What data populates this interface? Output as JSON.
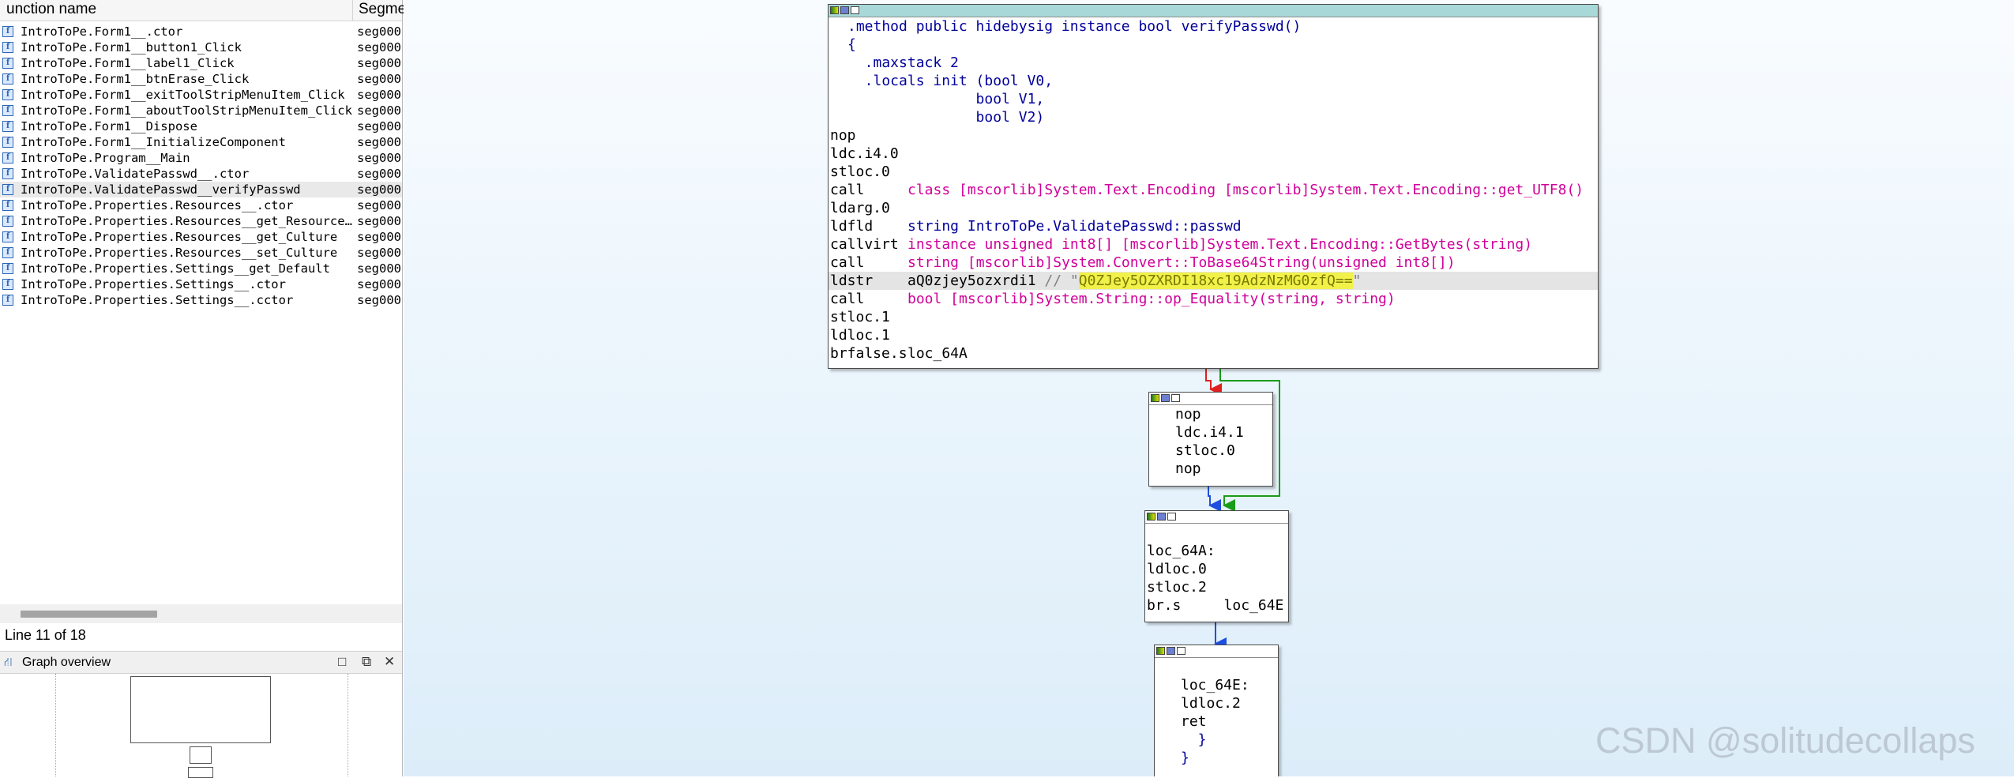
{
  "functions_panel": {
    "header": {
      "name": "unction name",
      "segment": "Segme"
    },
    "rows": [
      {
        "name": "IntroToPe.Form1__.ctor",
        "segment": "seg000"
      },
      {
        "name": "IntroToPe.Form1__button1_Click",
        "segment": "seg000"
      },
      {
        "name": "IntroToPe.Form1__label1_Click",
        "segment": "seg000"
      },
      {
        "name": "IntroToPe.Form1__btnErase_Click",
        "segment": "seg000"
      },
      {
        "name": "IntroToPe.Form1__exitToolStripMenuItem_Click",
        "segment": "seg000"
      },
      {
        "name": "IntroToPe.Form1__aboutToolStripMenuItem_Click",
        "segment": "seg000"
      },
      {
        "name": "IntroToPe.Form1__Dispose",
        "segment": "seg000"
      },
      {
        "name": "IntroToPe.Form1__InitializeComponent",
        "segment": "seg000"
      },
      {
        "name": "IntroToPe.Program__Main",
        "segment": "seg000"
      },
      {
        "name": "IntroToPe.ValidatePasswd__.ctor",
        "segment": "seg000"
      },
      {
        "name": "IntroToPe.ValidatePasswd__verifyPasswd",
        "segment": "seg000"
      },
      {
        "name": "IntroToPe.Properties.Resources__.ctor",
        "segment": "seg000"
      },
      {
        "name": "IntroToPe.Properties.Resources__get_Resource…",
        "segment": "seg000"
      },
      {
        "name": "IntroToPe.Properties.Resources__get_Culture",
        "segment": "seg000"
      },
      {
        "name": "IntroToPe.Properties.Resources__set_Culture",
        "segment": "seg000"
      },
      {
        "name": "IntroToPe.Properties.Settings__get_Default",
        "segment": "seg000"
      },
      {
        "name": "IntroToPe.Properties.Settings__.ctor",
        "segment": "seg000"
      },
      {
        "name": "IntroToPe.Properties.Settings__.cctor",
        "segment": "seg000"
      }
    ],
    "selected_index": 10,
    "status": "Line 11 of 18"
  },
  "graph_overview": {
    "title": "Graph overview",
    "buttons": [
      "□",
      "⧉",
      "✕"
    ]
  },
  "main_block": {
    "header_lines": [
      ".method public hidebysig instance bool verifyPasswd()",
      "{",
      "  .maxstack 2",
      "  .locals init (bool V0,",
      "               bool V1,",
      "               bool V2)"
    ],
    "instructions": [
      {
        "op": "nop",
        "operand": ""
      },
      {
        "op": "ldc.i4.0",
        "operand": ""
      },
      {
        "op": "stloc.0",
        "operand": ""
      },
      {
        "op": "call",
        "operand": "class [mscorlib]System.Text.Encoding [mscorlib]System.Text.Encoding::get_UTF8()"
      },
      {
        "op": "ldarg.0",
        "operand": ""
      },
      {
        "op": "ldfld",
        "operand": "string IntroToPe.ValidatePasswd::passwd"
      },
      {
        "op": "callvirt",
        "operand": "instance unsigned int8[] [mscorlib]System.Text.Encoding::GetBytes(string)"
      },
      {
        "op": "call",
        "operand": "string [mscorlib]System.Convert::ToBase64String(unsigned int8[])"
      },
      {
        "op": "ldstr",
        "operand": "aQ0zjey5ozxrdi1",
        "comment_prefix": " // \"",
        "string": "Q0ZJey5OZXRDI18xc19AdzNzMG0zfQ==",
        "comment_suffix": "\""
      },
      {
        "op": "call",
        "operand": "bool [mscorlib]System.String::op_Equality(string, string)"
      },
      {
        "op": "stloc.1",
        "operand": ""
      },
      {
        "op": "ldloc.1",
        "operand": ""
      },
      {
        "op": "brfalse.s",
        "operand": "loc_64A"
      }
    ]
  },
  "block2": {
    "lines": [
      "nop",
      "ldc.i4.1",
      "stloc.0",
      "nop"
    ]
  },
  "block3": {
    "lines": [
      "",
      "loc_64A:",
      "ldloc.0",
      "stloc.2",
      "br.s     loc_64E"
    ]
  },
  "block4": {
    "lines": [
      "",
      "loc_64E:",
      "ldloc.2",
      "ret",
      "  }",
      "}"
    ]
  },
  "watermark": "CSDN @solitudecollaps",
  "colors": {
    "true_edge": "#1a9c1a",
    "false_edge": "#e02020",
    "flow_edge": "#1f4fe0",
    "titlebar": "#a8d8d8"
  }
}
